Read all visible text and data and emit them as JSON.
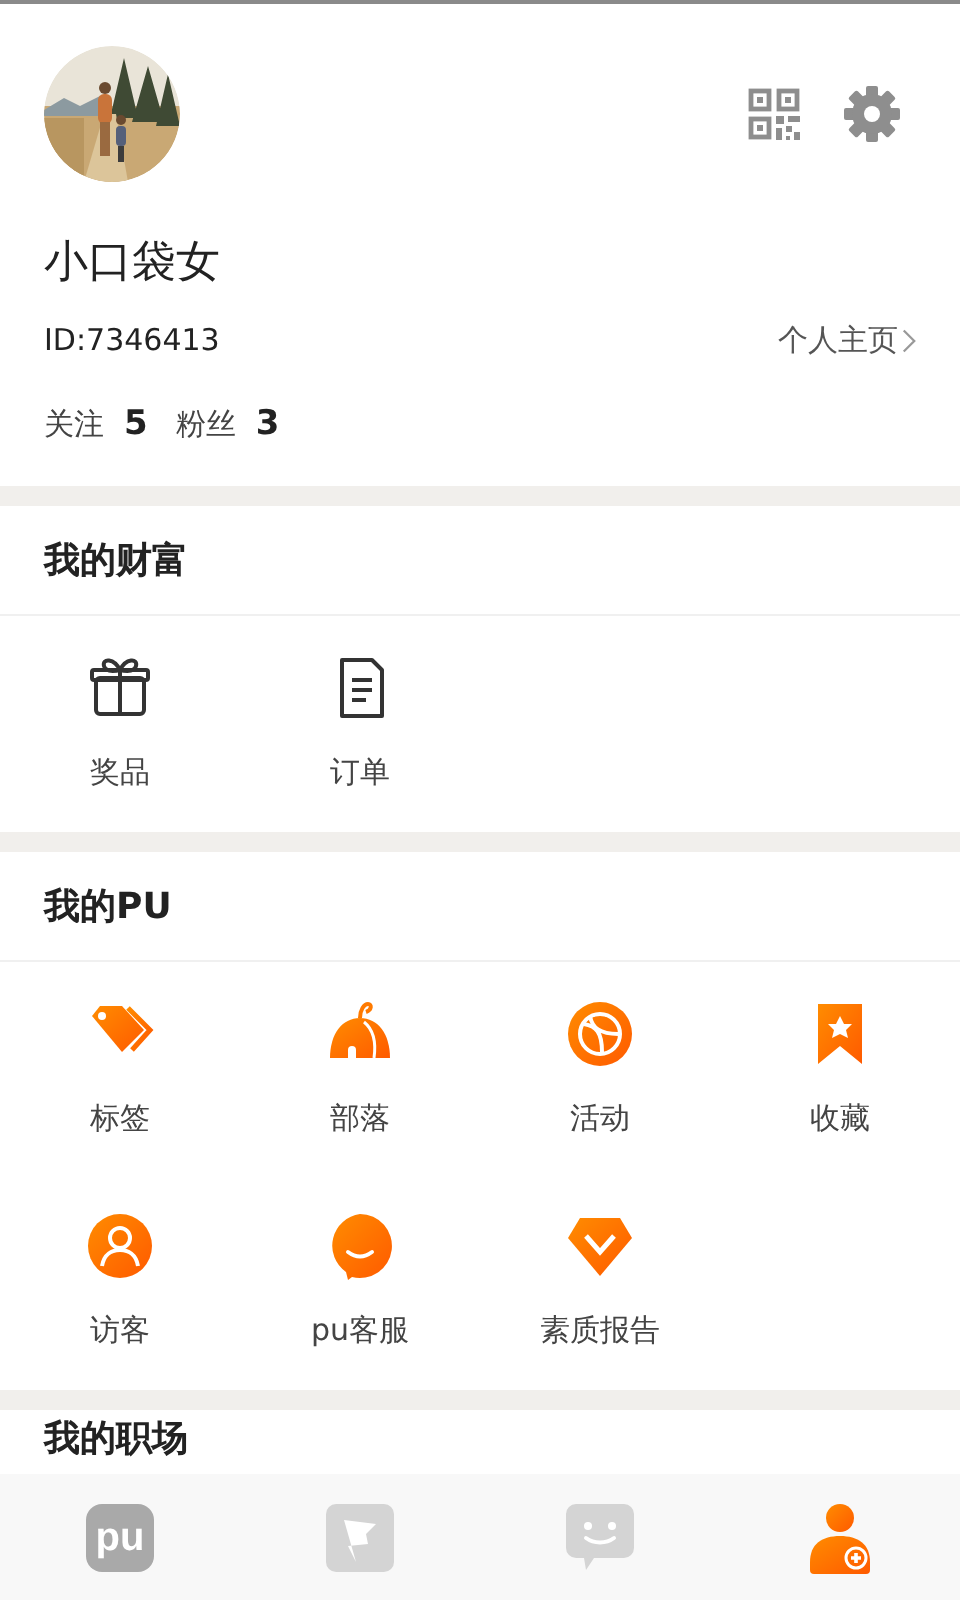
{
  "profile": {
    "name": "小口袋女",
    "id": "ID:7346413",
    "homepage_link": "个人主页",
    "stats": [
      {
        "label": "关注",
        "value": "5"
      },
      {
        "label": "粉丝",
        "value": "3"
      }
    ]
  },
  "sections": [
    {
      "title": "我的财富",
      "items": [
        {
          "label": "奖品",
          "kind": "gift"
        },
        {
          "label": "订单",
          "kind": "order"
        }
      ]
    },
    {
      "title": "我的PU",
      "items": [
        {
          "label": "标签",
          "kind": "tag"
        },
        {
          "label": "部落",
          "kind": "tent"
        },
        {
          "label": "活动",
          "kind": "ball"
        },
        {
          "label": "收藏",
          "kind": "bookmark"
        },
        {
          "label": "访客",
          "kind": "visitor"
        },
        {
          "label": "pu客服",
          "kind": "service"
        },
        {
          "label": "素质报告",
          "kind": "gem"
        }
      ]
    },
    {
      "title": "我的职场"
    }
  ],
  "bottom_nav": [
    {
      "kind": "home",
      "logo_text": "pu",
      "selected": false
    },
    {
      "kind": "flag",
      "selected": false
    },
    {
      "kind": "chat",
      "selected": false
    },
    {
      "kind": "me",
      "selected": true
    }
  ]
}
